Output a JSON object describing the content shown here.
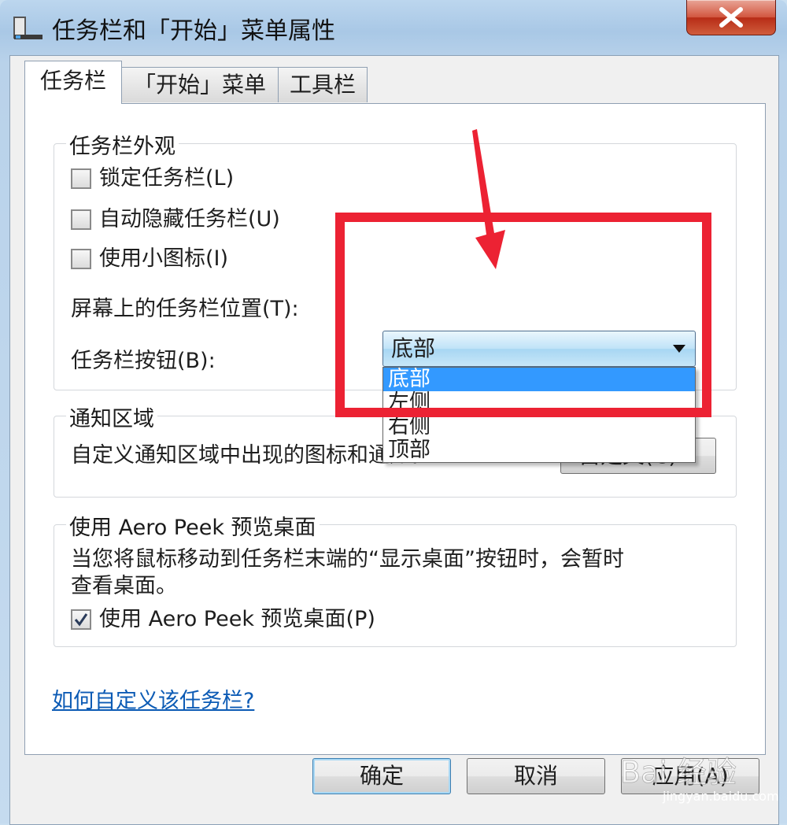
{
  "window": {
    "title": "任务栏和「开始」菜单属性",
    "close_glyph": "✕"
  },
  "tabs": [
    {
      "label": "任务栏",
      "active": true
    },
    {
      "label": "「开始」菜单",
      "active": false
    },
    {
      "label": "工具栏",
      "active": false
    }
  ],
  "appearance": {
    "legend": "任务栏外观",
    "lock_label": "锁定任务栏(L)",
    "lock_checked": false,
    "autohide_label": "自动隐藏任务栏(U)",
    "autohide_checked": false,
    "small_icons_label": "使用小图标(I)",
    "small_icons_checked": false,
    "position_label": "屏幕上的任务栏位置(T):",
    "position_value": "底部",
    "position_options": [
      "底部",
      "左侧",
      "右侧",
      "顶部"
    ],
    "buttons_label": "任务栏按钮(B):"
  },
  "notification": {
    "legend": "通知区域",
    "description": "自定义通知区域中出现的图标和通知。",
    "customize_button": "自定义(C)..."
  },
  "aero_peek": {
    "legend": "使用 Aero Peek 预览桌面",
    "description_line1": "当您将鼠标移动到任务栏末端的“显示桌面”按钮时，会暂时",
    "description_line2": "查看桌面。",
    "checkbox_label": "使用 Aero Peek 预览桌面(P)",
    "checked": true
  },
  "help_link": "如何自定义该任务栏?",
  "footer": {
    "ok": "确定",
    "cancel": "取消",
    "apply": "应用(A)"
  },
  "watermark": {
    "brand": "Bai 经验",
    "url": "jingyan.baidu.com"
  },
  "colors": {
    "highlight_box": "#ec2233",
    "selection": "#3399ff",
    "link": "#0c5bb5"
  }
}
